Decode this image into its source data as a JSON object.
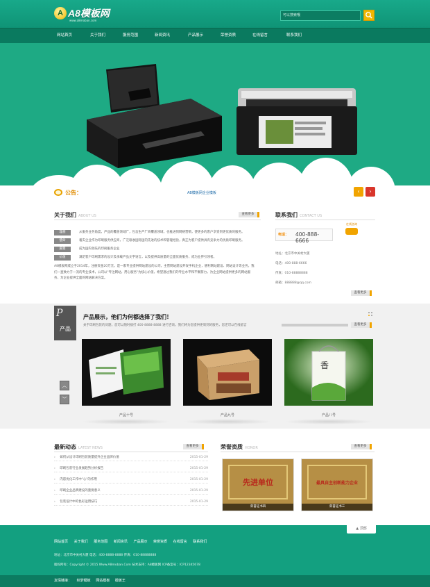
{
  "header": {
    "logo_letter": "A",
    "logo_text": "A8模板网",
    "logo_sub": "www.a8moban.com",
    "search_placeholder": "可以搜索哦"
  },
  "nav": {
    "items": [
      "网站首页",
      "关于我们",
      "服务范围",
      "新闻资讯",
      "产品展示",
      "荣誉资质",
      "在线留言",
      "联系我们"
    ]
  },
  "notice": {
    "title": "公告：",
    "text": "AB模板网企业模板"
  },
  "about": {
    "title": "关于我们",
    "title_en": "ABOUT US",
    "more": "查看更多",
    "rows": [
      {
        "tag": "理想",
        "text": "从服务业务角度，产品的覆盖领域广，包含生产厂商覆盖领域，也推进到网络营销，使更多的客户享受到更优质的服务。"
      },
      {
        "tag": "使命",
        "text": "着实企业作为印刷服务供应商，广泛吸收国际国内先进的技术和管理经验，真正为客户提供具有竞争力的优质印刷服务。"
      },
      {
        "tag": "愿景",
        "text": "成为国内领先的印刷服务企业"
      },
      {
        "tag": "价值",
        "text": "满足客户印刷需求的设计及承载产品文字语言，以及提供高质量的全面优质服务，成为业界引领者。"
      }
    ],
    "paragraph": "A8模板网成立于2014年，注册资金20万元，是一家专业提供网站建设的公司，主营网站建设开发手机企业，便利网站建设、网站设计等业务，我们一直致力于一流的专业技术，公司以\"专注网站，用心服务\"为核心价值，希望通过我们的专业水平和不懈努力，为企业网站提供更多的网站服务，为企业提供全面的网站解决方案。"
  },
  "contact": {
    "title": "联系我们",
    "title_en": "CONTACT US",
    "online": "在线咨询",
    "phone_label": "电话：",
    "phone": "400-888-6666",
    "more": "查看更多",
    "lines": [
      "地址：北京市中关村大厦",
      "电话：400-888-6666",
      "传真：010-88888888",
      "邮箱：888888@qq.com"
    ]
  },
  "products": {
    "badge_letter": "P",
    "badge_text": "产品",
    "heading": "产品展示，他们为何都选择了我们！",
    "subheading": "关于印刷包装的问题，您可以随时拨打 400-8888-8888 进行咨询，我们将为您提供更周到的服务，您还可以在线留言",
    "more": "查看更多",
    "items": [
      "产品十号",
      "产品九号",
      "产品八号"
    ]
  },
  "news": {
    "title": "最新动态",
    "title_en": "LATEST NEWS",
    "more": "查看更多",
    "items": [
      {
        "title": "如何从设计印刷包装质量提升企业品牌价值",
        "date": "2015-01-29"
      },
      {
        "title": "印刷包装行业发展趋势分析报告",
        "date": "2015-01-29"
      },
      {
        "title": "内容优化工作中\"心\"的作用",
        "date": "2015-01-29"
      },
      {
        "title": "印刷企业品牌建设的重要意义",
        "date": "2015-01-29"
      },
      {
        "title": "包装设计中的色彩运用技巧",
        "date": "2015-01-29"
      }
    ]
  },
  "honors": {
    "title": "荣誉资质",
    "title_en": "HONOR",
    "more": "查看更多",
    "items": [
      {
        "cert_text": "先进单位",
        "caption": "荣誉证书四"
      },
      {
        "cert_text": "最具自主创新能力企业",
        "caption": "荣誉证书三"
      }
    ]
  },
  "footer": {
    "top_label": "顶部",
    "nav": [
      "网站首页",
      "关于我们",
      "服务范围",
      "新闻资讯",
      "产品展示",
      "荣誉资质",
      "在线留言",
      "联系我们"
    ],
    "lines": [
      "地址：北京市中关村大厦  电话：400-8888-8888  传真：010-88888888",
      "版权所有：Copyright © 2015 Www.A8moban.Com  技术支持：A8模板网  ICP备案号：ICP12345678"
    ],
    "links_label": "友情链接：",
    "links": [
      "织梦模板",
      "网站模板",
      "模板王"
    ]
  },
  "colors": {
    "brand": "#13a080",
    "nav": "#0a7a5f",
    "accent": "#f1a400"
  }
}
